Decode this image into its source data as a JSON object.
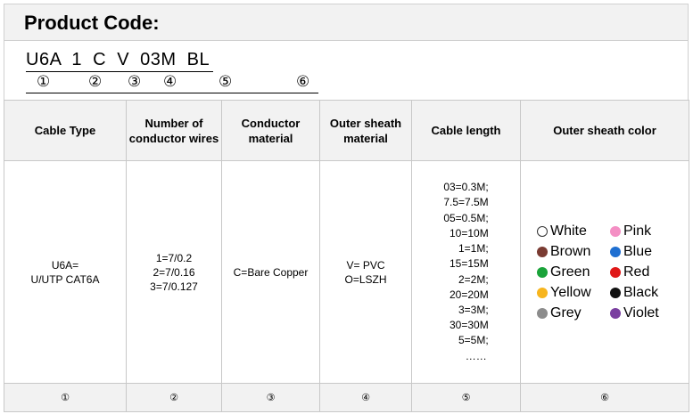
{
  "header": {
    "title": "Product Code:"
  },
  "code": {
    "text": "U6A  1  C  V  03M  BL",
    "markers": [
      "①",
      "②",
      "③",
      "④",
      "⑤",
      "⑥"
    ]
  },
  "table": {
    "columns": [
      "Cable Type",
      "Number of conductor wires",
      "Conductor material",
      "Outer sheath material",
      "Cable length",
      "Outer sheath color"
    ],
    "cable_type": [
      "U6A=",
      "U/UTP  CAT6A"
    ],
    "conductor_wires": [
      "1=7/0.2",
      "2=7/0.16",
      "3=7/0.127"
    ],
    "conductor_material": "C=Bare Copper",
    "sheath_material": [
      "V= PVC",
      "O=LSZH"
    ],
    "lengths": [
      "03=0.3M;",
      "7.5=7.5M",
      "05=0.5M;",
      "10=10M",
      "1=1M;",
      "15=15M",
      "2=2M;",
      "20=20M",
      "3=3M;",
      "30=30M",
      "5=5M;"
    ],
    "lengths_more": "……",
    "colors": [
      {
        "name": "White",
        "hex": "#ffffff"
      },
      {
        "name": "Pink",
        "hex": "#f48fc4"
      },
      {
        "name": "Brown",
        "hex": "#7a3b32"
      },
      {
        "name": "Blue",
        "hex": "#1f6fd1"
      },
      {
        "name": "Green",
        "hex": "#1aa33a"
      },
      {
        "name": "Red",
        "hex": "#e01818"
      },
      {
        "name": "Yellow",
        "hex": "#f7b51e"
      },
      {
        "name": "Black",
        "hex": "#111111"
      },
      {
        "name": "Grey",
        "hex": "#8c8c8c"
      },
      {
        "name": "Violet",
        "hex": "#7a3fa0"
      }
    ],
    "footer_markers": [
      "①",
      "②",
      "③",
      "④",
      "⑤",
      "⑥"
    ]
  }
}
